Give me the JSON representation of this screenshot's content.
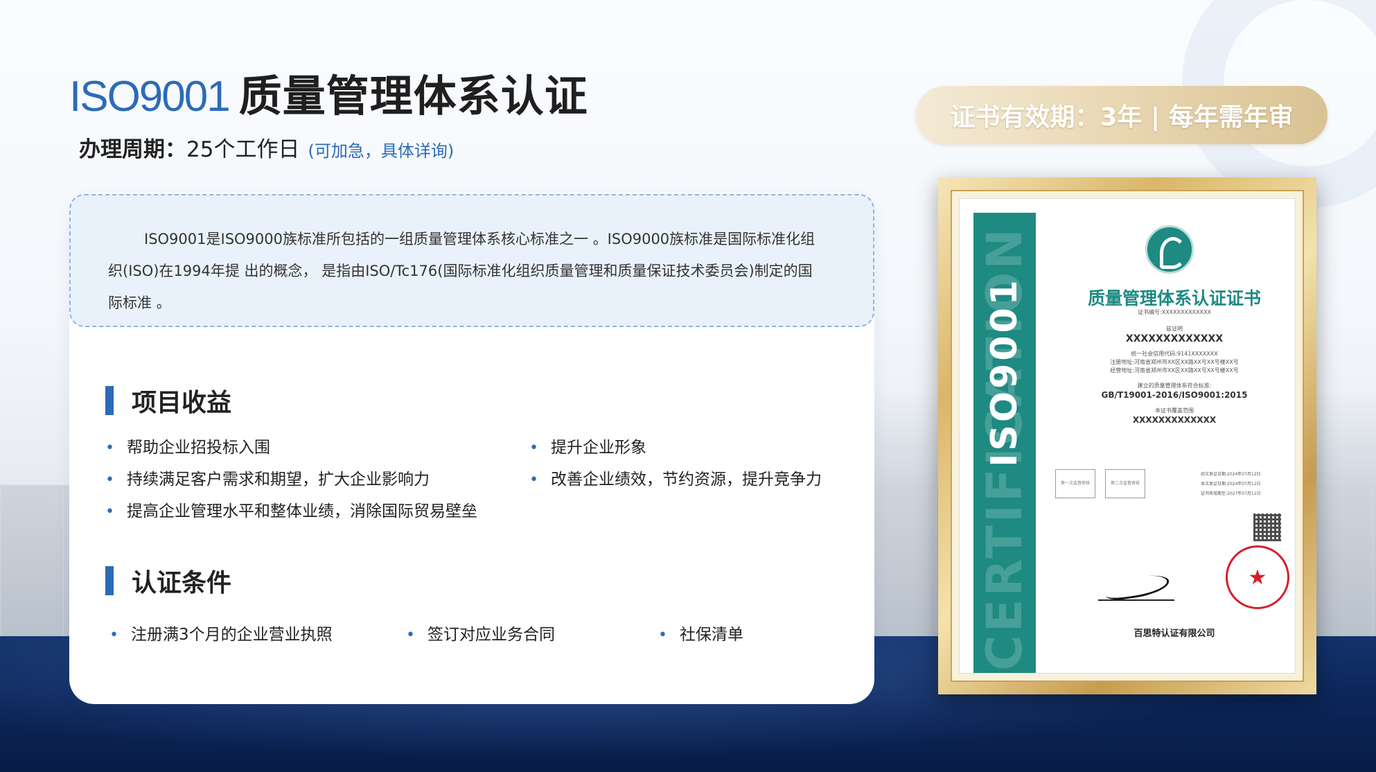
{
  "header": {
    "title_iso": "ISO9001",
    "title_rest": "质量管理体系认证",
    "period_label": "办理周期：",
    "period_value": "25个工作日",
    "period_note": "(可加急，具体详询)"
  },
  "validity_badge": "证书有效期：3年 | 每年需年审",
  "intro": "ISO9001是ISO9000族标准所包括的一组质量管理体系核心标准之一 。ISO9000族标准是国际标准化组织(ISO)在1994年提 出的概念，  是指由ISO/Tc176(国际标准化组织质量管理和质量保证技术委员会)制定的国际标准 。",
  "benefits": {
    "heading": "项目收益",
    "items": [
      "帮助企业招投标入围",
      "提升企业形象",
      "持续满足客户需求和期望，扩大企业影响力",
      "改善企业绩效，节约资源，提升竞争力",
      "提高企业管理水平和整体业绩，消除国际贸易壁垒"
    ]
  },
  "conditions": {
    "heading": "认证条件",
    "items": [
      "注册满3个月的企业营业执照",
      "签订对应业务合同",
      "社保清单"
    ]
  },
  "certificate": {
    "band_iso": "ISO9001",
    "band_watermark": "CERTIFICATION",
    "title": "质量管理体系认证证书",
    "cert_no": "证书编号:XXXXXXXXXXXXX",
    "holder_label": "兹证明",
    "holder": "XXXXXXXXXXXXX",
    "credit_code": "统一社会信用代码:9141XXXXXXX",
    "reg_address": "注册地址:河南省郑州市XX区XX路XX号XX号楼XX号",
    "op_address": "经营地址:河南省郑州市XX区XX路XX号XX号楼XX号",
    "standard_label": "建立的质量管理体系符合标准:",
    "standard": "GB/T19001-2016/ISO9001:2015",
    "scope_label": "本证书覆盖范围",
    "scope": "XXXXXXXXXXXXX",
    "box1": "第一次监督审核",
    "box2": "第二次监督审核",
    "date1": "初次发证日期:2024年07月12日",
    "date2": "本次发证日期:2024年07月12日",
    "date3": "证书有效期至:2027年07月11日",
    "company": "百思特认证有限公司",
    "seal_star": "★"
  },
  "colors": {
    "accent": "#2c6bb8",
    "teal": "#1e8a82",
    "gold": "#d9b66a",
    "seal_red": "#d81e28"
  }
}
